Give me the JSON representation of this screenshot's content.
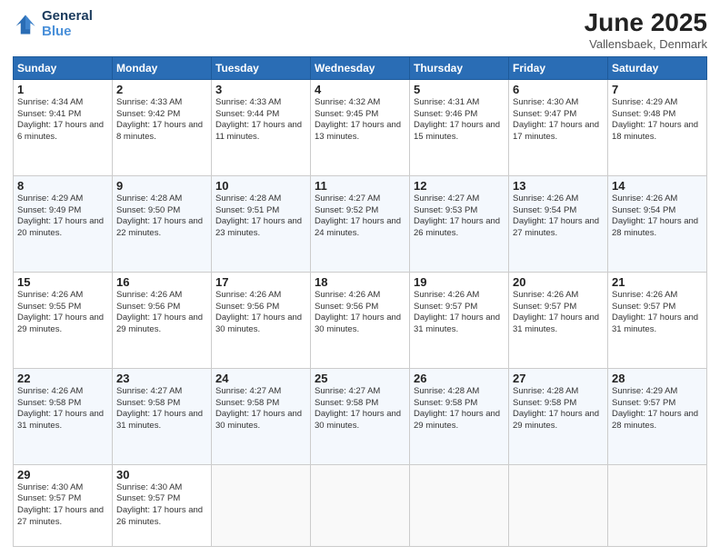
{
  "header": {
    "logo_line1": "General",
    "logo_line2": "Blue",
    "month": "June 2025",
    "location": "Vallensbaek, Denmark"
  },
  "weekdays": [
    "Sunday",
    "Monday",
    "Tuesday",
    "Wednesday",
    "Thursday",
    "Friday",
    "Saturday"
  ],
  "weeks": [
    [
      {
        "day": "1",
        "rise": "4:34 AM",
        "set": "9:41 PM",
        "daylight": "17 hours and 6 minutes."
      },
      {
        "day": "2",
        "rise": "4:33 AM",
        "set": "9:42 PM",
        "daylight": "17 hours and 8 minutes."
      },
      {
        "day": "3",
        "rise": "4:33 AM",
        "set": "9:44 PM",
        "daylight": "17 hours and 11 minutes."
      },
      {
        "day": "4",
        "rise": "4:32 AM",
        "set": "9:45 PM",
        "daylight": "17 hours and 13 minutes."
      },
      {
        "day": "5",
        "rise": "4:31 AM",
        "set": "9:46 PM",
        "daylight": "17 hours and 15 minutes."
      },
      {
        "day": "6",
        "rise": "4:30 AM",
        "set": "9:47 PM",
        "daylight": "17 hours and 17 minutes."
      },
      {
        "day": "7",
        "rise": "4:29 AM",
        "set": "9:48 PM",
        "daylight": "17 hours and 18 minutes."
      }
    ],
    [
      {
        "day": "8",
        "rise": "4:29 AM",
        "set": "9:49 PM",
        "daylight": "17 hours and 20 minutes."
      },
      {
        "day": "9",
        "rise": "4:28 AM",
        "set": "9:50 PM",
        "daylight": "17 hours and 22 minutes."
      },
      {
        "day": "10",
        "rise": "4:28 AM",
        "set": "9:51 PM",
        "daylight": "17 hours and 23 minutes."
      },
      {
        "day": "11",
        "rise": "4:27 AM",
        "set": "9:52 PM",
        "daylight": "17 hours and 24 minutes."
      },
      {
        "day": "12",
        "rise": "4:27 AM",
        "set": "9:53 PM",
        "daylight": "17 hours and 26 minutes."
      },
      {
        "day": "13",
        "rise": "4:26 AM",
        "set": "9:54 PM",
        "daylight": "17 hours and 27 minutes."
      },
      {
        "day": "14",
        "rise": "4:26 AM",
        "set": "9:54 PM",
        "daylight": "17 hours and 28 minutes."
      }
    ],
    [
      {
        "day": "15",
        "rise": "4:26 AM",
        "set": "9:55 PM",
        "daylight": "17 hours and 29 minutes."
      },
      {
        "day": "16",
        "rise": "4:26 AM",
        "set": "9:56 PM",
        "daylight": "17 hours and 29 minutes."
      },
      {
        "day": "17",
        "rise": "4:26 AM",
        "set": "9:56 PM",
        "daylight": "17 hours and 30 minutes."
      },
      {
        "day": "18",
        "rise": "4:26 AM",
        "set": "9:56 PM",
        "daylight": "17 hours and 30 minutes."
      },
      {
        "day": "19",
        "rise": "4:26 AM",
        "set": "9:57 PM",
        "daylight": "17 hours and 31 minutes."
      },
      {
        "day": "20",
        "rise": "4:26 AM",
        "set": "9:57 PM",
        "daylight": "17 hours and 31 minutes."
      },
      {
        "day": "21",
        "rise": "4:26 AM",
        "set": "9:57 PM",
        "daylight": "17 hours and 31 minutes."
      }
    ],
    [
      {
        "day": "22",
        "rise": "4:26 AM",
        "set": "9:58 PM",
        "daylight": "17 hours and 31 minutes."
      },
      {
        "day": "23",
        "rise": "4:27 AM",
        "set": "9:58 PM",
        "daylight": "17 hours and 31 minutes."
      },
      {
        "day": "24",
        "rise": "4:27 AM",
        "set": "9:58 PM",
        "daylight": "17 hours and 30 minutes."
      },
      {
        "day": "25",
        "rise": "4:27 AM",
        "set": "9:58 PM",
        "daylight": "17 hours and 30 minutes."
      },
      {
        "day": "26",
        "rise": "4:28 AM",
        "set": "9:58 PM",
        "daylight": "17 hours and 29 minutes."
      },
      {
        "day": "27",
        "rise": "4:28 AM",
        "set": "9:58 PM",
        "daylight": "17 hours and 29 minutes."
      },
      {
        "day": "28",
        "rise": "4:29 AM",
        "set": "9:57 PM",
        "daylight": "17 hours and 28 minutes."
      }
    ],
    [
      {
        "day": "29",
        "rise": "4:30 AM",
        "set": "9:57 PM",
        "daylight": "17 hours and 27 minutes."
      },
      {
        "day": "30",
        "rise": "4:30 AM",
        "set": "9:57 PM",
        "daylight": "17 hours and 26 minutes."
      },
      null,
      null,
      null,
      null,
      null
    ]
  ]
}
